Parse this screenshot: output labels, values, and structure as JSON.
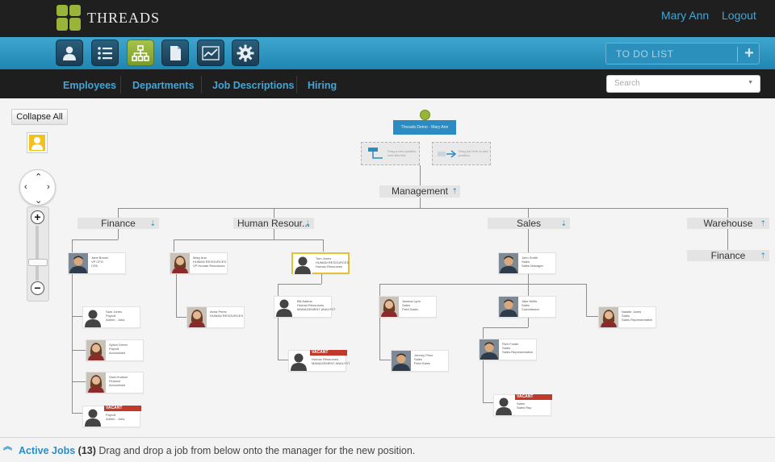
{
  "app": {
    "brand": "THREADS"
  },
  "header": {
    "user_name": "Mary Ann",
    "logout_label": "Logout"
  },
  "toolbar": {
    "tools": [
      {
        "icon": "person-icon"
      },
      {
        "icon": "list-icon"
      },
      {
        "icon": "org-chart-icon",
        "active": true
      },
      {
        "icon": "document-icon"
      },
      {
        "icon": "line-chart-icon"
      },
      {
        "icon": "gear-icon"
      }
    ],
    "todo_label": "TO DO LIST",
    "todo_add": "+"
  },
  "nav": {
    "items": [
      "Employees",
      "Departments",
      "Job Descriptions",
      "Hiring"
    ]
  },
  "search": {
    "placeholder": "Search",
    "caret": "▼"
  },
  "controls": {
    "collapse_label": "Collapse All",
    "zoom_in": "+",
    "zoom_out": "−",
    "zoom_level": 0.35
  },
  "org": {
    "root": {
      "label": "Threads Demo · Mary Ann"
    },
    "drop_zones": [
      {
        "text": "Drag a new position onto this line"
      },
      {
        "text": "Drag job here to add position"
      }
    ],
    "management": {
      "label": "Management"
    },
    "departments": [
      {
        "label": "Finance",
        "chev": "⇣"
      },
      {
        "label": "Human Resour...",
        "chev": "⇣"
      },
      {
        "label": "Sales",
        "chev": "⇣"
      },
      {
        "label": "Warehouse",
        "chev": "⇡"
      },
      {
        "label": "Finance",
        "chev": "⇡"
      }
    ],
    "cards": [
      {
        "lines": [
          "Jane Brown",
          "VP CFO",
          "CPA"
        ],
        "photo": "man"
      },
      {
        "lines": [
          "Sam Jones",
          "Payroll",
          "Admin - Jobs"
        ],
        "photo": "silhouette"
      },
      {
        "lines": [
          "Sylvia Green",
          "Payroll",
          "Accountant"
        ],
        "photo": "woman"
      },
      {
        "lines": [
          "Sara Hudson",
          "Finance",
          "Accountant"
        ],
        "photo": "woman"
      },
      {
        "lines": [
          "Payroll",
          "Admin - Jobs"
        ],
        "photo": "silhouette",
        "vacant": "VACANT"
      },
      {
        "lines": [
          "Mary Ann",
          "HUMAN RESOURCES",
          "VP Human Resources"
        ],
        "photo": "woman"
      },
      {
        "lines": [
          "Anna Perez",
          "HUMAN RESOURCES"
        ],
        "photo": "woman"
      },
      {
        "lines": [
          "Tom Jones",
          "HUMAN RESOURCES",
          "Human Resources"
        ],
        "photo": "silhouette",
        "selected": true
      },
      {
        "lines": [
          "Bill Adams",
          "Human Resources",
          "MANAGEMENT ANALYST"
        ],
        "photo": "silhouette"
      },
      {
        "lines": [
          "Human Resources",
          "MANAGEMENT ANALYST"
        ],
        "photo": "silhouette",
        "vacant": "VACANT"
      },
      {
        "lines": [
          "John Smith",
          "Sales",
          "Sales Manager"
        ],
        "photo": "man"
      },
      {
        "lines": [
          "Jessica Lynn",
          "Sales",
          "Field Sales"
        ],
        "photo": "woman"
      },
      {
        "lines": [
          "Jeremy Price",
          "Sales",
          "Field Sales"
        ],
        "photo": "man"
      },
      {
        "lines": [
          "Jake Wells",
          "Sales",
          "Commission"
        ],
        "photo": "man"
      },
      {
        "lines": [
          "Rich Foster",
          "Sales",
          "Sales Representative"
        ],
        "photo": "man"
      },
      {
        "lines": [
          "Sales",
          "Sales Rep"
        ],
        "photo": "silhouette",
        "vacant": "VACANT"
      },
      {
        "lines": [
          "Natalie Jones",
          "Sales",
          "Sales Representative"
        ],
        "photo": "woman"
      }
    ]
  },
  "footer": {
    "link": "Active Jobs",
    "count": "(13)",
    "text": " Drag and drop a job from below onto the manager for the new position."
  },
  "colors": {
    "accent": "#2b8cc4",
    "brand_green": "#98b53a",
    "vacant_red": "#c0392b",
    "selected_gold": "#e3c23a"
  }
}
